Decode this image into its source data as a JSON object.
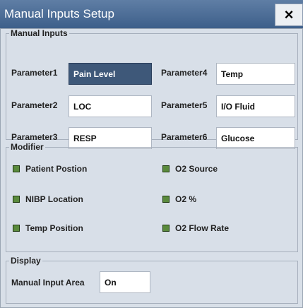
{
  "window": {
    "title": "Manual Inputs Setup",
    "close_label": "×"
  },
  "manual_inputs": {
    "legend": "Manual Inputs",
    "params": [
      {
        "label": "Parameter1",
        "value": "Pain Level",
        "selected": true
      },
      {
        "label": "Parameter2",
        "value": "LOC"
      },
      {
        "label": "Parameter3",
        "value": "RESP"
      },
      {
        "label": "Parameter4",
        "value": "Temp"
      },
      {
        "label": "Parameter5",
        "value": "I/O Fluid"
      },
      {
        "label": "Parameter6",
        "value": "Glucose"
      }
    ]
  },
  "modifier": {
    "legend": "Modifier",
    "items": [
      {
        "label": "Patient Postion"
      },
      {
        "label": "NIBP Location"
      },
      {
        "label": "Temp Position"
      },
      {
        "label": "O2 Source"
      },
      {
        "label": "O2 %"
      },
      {
        "label": "O2 Flow Rate"
      }
    ]
  },
  "display": {
    "legend": "Display",
    "label": "Manual Input Area",
    "value": "On"
  }
}
